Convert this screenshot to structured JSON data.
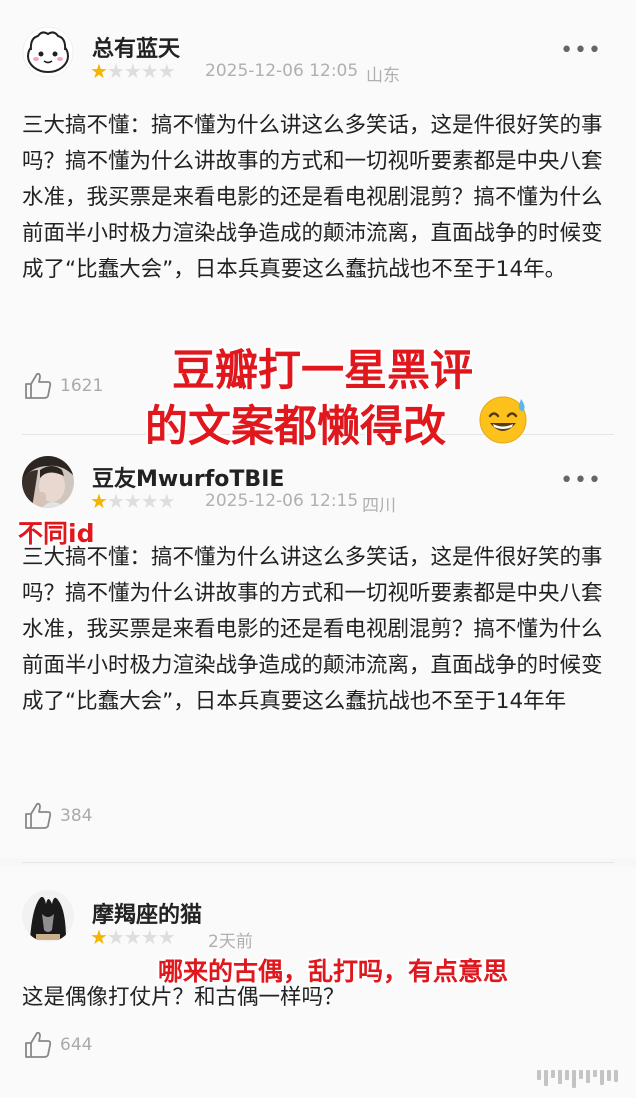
{
  "reviews": [
    {
      "username": "总有蓝天",
      "rating": 1,
      "max_rating": 5,
      "date": "2025-12-06 12:05",
      "location": "山东",
      "content": "三大搞不懂：搞不懂为什么讲这么多笑话，这是件很好笑的事吗？搞不懂为什么讲故事的方式和一切视听要素都是中央八套水准，我买票是来看电影的还是看电视剧混剪？搞不懂为什么前面半小时极力渲染战争造成的颠沛流离，直面战争的时候变成了“比蠢大会”，日本兵真要这么蠢抗战也不至于14年。",
      "likes": "1621"
    },
    {
      "username": "豆友MwurfoTBIE",
      "rating": 1,
      "max_rating": 5,
      "date": "2025-12-06 12:15",
      "location": "四川",
      "content": "三大搞不懂：搞不懂为什么讲这么多笑话，这是件很好笑的事吗？搞不懂为什么讲故事的方式和一切视听要素都是中央八套水准，我买票是来看电影的还是看电视剧混剪？搞不懂为什么前面半小时极力渲染战争造成的颠沛流离，直面战争的时候变成了“比蠢大会”，日本兵真要这么蠢抗战也不至于14年年",
      "likes": "384"
    },
    {
      "username": "摩羯座的猫",
      "rating": 1,
      "max_rating": 5,
      "date": "2天前",
      "location": "",
      "content": "这是偶像打仗片？和古偶一样吗？",
      "likes": "644"
    }
  ],
  "annotations": {
    "headline_line1": "豆瓣打一星黑评",
    "headline_line2": "的文案都懒得改",
    "headline_emoji": "sweat-smile-emoji",
    "different_id": "不同id",
    "comment3_note": "哪来的古偶，乱打吗，有点意思"
  },
  "icons": {
    "more": "more-dots-icon",
    "like": "thumbs-up-icon",
    "star": "star-icon"
  },
  "colors": {
    "star_active": "#f5b400",
    "star_inactive": "#dedede",
    "annotation_red": "#e0181e",
    "meta_gray": "#b0b0b0"
  }
}
